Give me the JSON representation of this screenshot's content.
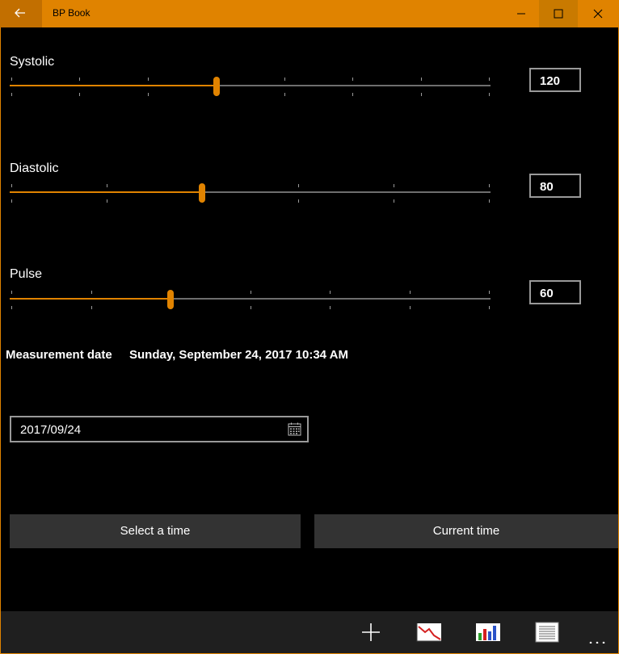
{
  "window": {
    "title": "BP Book",
    "accent": "#e08300"
  },
  "sliders": [
    {
      "label": "Systolic",
      "value": "120",
      "level": 0.43,
      "ticks": 8
    },
    {
      "label": "Diastolic",
      "value": "80",
      "level": 0.4,
      "ticks": 6
    },
    {
      "label": "Pulse",
      "value": "60",
      "level": 0.335,
      "ticks": 7
    }
  ],
  "measurement": {
    "label": "Measurement date",
    "value": "Sunday, September 24, 2017 10:34 AM"
  },
  "date_picker": {
    "value": "2017/09/24",
    "icon": "calendar-icon"
  },
  "buttons": {
    "select_time": "Select a time",
    "current_time": "Current time"
  },
  "appbar": {
    "icons": [
      "add-icon",
      "line-chart-icon",
      "bar-chart-icon",
      "list-icon",
      "more-icon"
    ]
  }
}
